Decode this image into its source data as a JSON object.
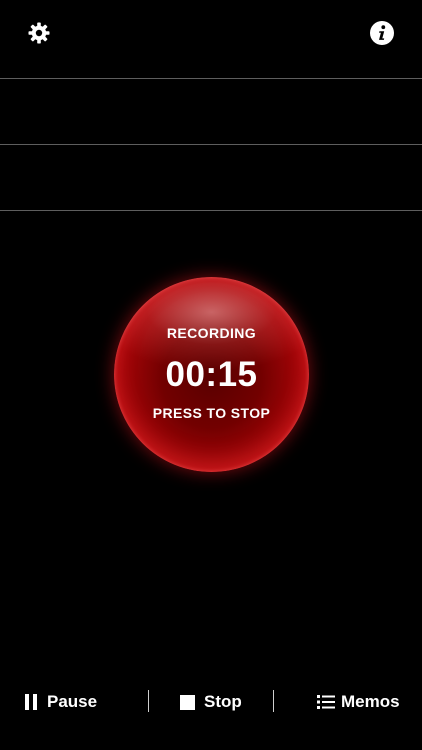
{
  "header": {
    "settings_icon": "gear-icon",
    "info_icon": "info-icon"
  },
  "recorder": {
    "status_label": "RECORDING",
    "elapsed_time": "00:15",
    "action_hint": "PRESS TO STOP",
    "button_color": "#d0141a"
  },
  "toolbar": {
    "pause_label": "Pause",
    "stop_label": "Stop",
    "memos_label": "Memos"
  },
  "colors": {
    "background": "#000000",
    "text": "#ffffff",
    "divider": "#5e5e5e"
  }
}
